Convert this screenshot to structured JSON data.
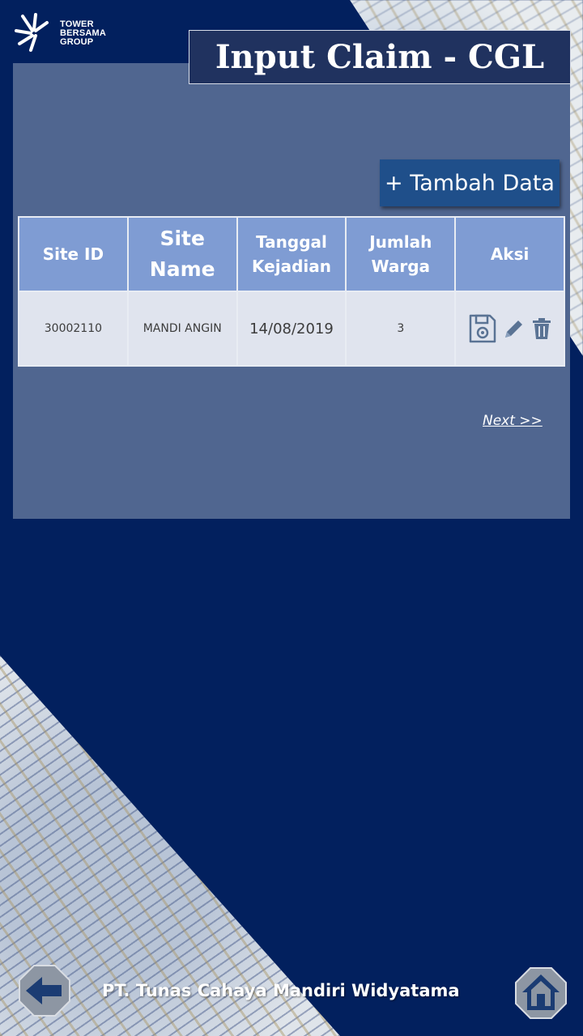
{
  "logo": {
    "line1": "TOWER",
    "line2": "BERSAMA",
    "line3": "GROUP"
  },
  "page_title": "Input Claim - CGL",
  "add_button": "+ Tambah Data",
  "table": {
    "headers": {
      "site_id": "Site ID",
      "site_name": "Site Name",
      "tanggal": "Tanggal Kejadian",
      "jumlah": "Jumlah Warga",
      "aksi": "Aksi"
    },
    "rows": [
      {
        "site_id": "30002110",
        "site_name": "MANDI ANGIN",
        "tanggal": "14/08/2019",
        "jumlah": "3"
      }
    ]
  },
  "pagination": {
    "next": "Next >>"
  },
  "footer": {
    "company": "PT. Tunas Cahaya Mandiri Widyatama"
  },
  "icons": {
    "save": "save-icon",
    "edit": "pencil-icon",
    "delete": "trash-icon",
    "back": "arrow-left-icon",
    "home": "home-icon"
  },
  "colors": {
    "background": "#02205e",
    "panel": "#506690",
    "header": "#7f9cd3",
    "row": "#e0e4ee",
    "button": "#1f4f8a"
  }
}
